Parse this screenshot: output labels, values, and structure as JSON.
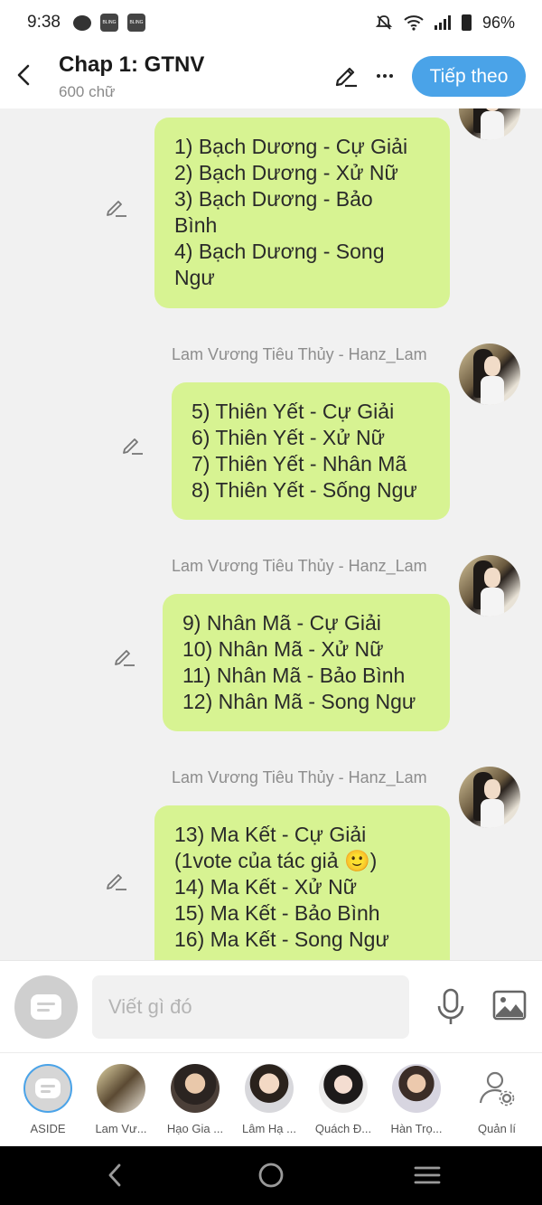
{
  "status_bar": {
    "time": "9:38",
    "battery": "96%",
    "app_icon_text": "BLING"
  },
  "header": {
    "title": "Chap 1: GTNV",
    "subtitle": "600 chữ",
    "next_label": "Tiếp theo"
  },
  "messages": [
    {
      "sender": "",
      "lines": [
        "1) Bạch Dương - Cự Giải",
        "2) Bạch Dương - Xử Nữ",
        "3) Bạch Dương - Bảo",
        "Bình",
        "4) Bạch Dương - Song",
        "Ngư"
      ]
    },
    {
      "sender": "Lam Vương Tiêu Thủy - Hanz_Lam",
      "lines": [
        "5) Thiên Yết - Cự Giải",
        "6) Thiên Yết - Xử Nữ",
        "7) Thiên Yết - Nhân Mã",
        "8) Thiên Yết - Sống Ngư"
      ]
    },
    {
      "sender": "Lam Vương Tiêu Thủy - Hanz_Lam",
      "lines": [
        "9) Nhân Mã - Cự Giải",
        "10) Nhân Mã - Xử Nữ",
        "11) Nhân Mã - Bảo Bình",
        "12) Nhân Mã - Song Ngư"
      ]
    },
    {
      "sender": "Lam Vương Tiêu Thủy - Hanz_Lam",
      "lines": [
        "13) Ma Kết - Cự Giải",
        "(1vote của tác giả 🙂)",
        "14) Ma Kết - Xử Nữ",
        "15) Ma Kết - Bảo Bình",
        "16) Ma Kết - Song Ngư"
      ]
    }
  ],
  "input": {
    "placeholder": "Viết gì đó"
  },
  "characters": [
    {
      "label": "ASIDE"
    },
    {
      "label": "Lam Vư..."
    },
    {
      "label": "Hạo Gia ..."
    },
    {
      "label": "Lâm Hạ ..."
    },
    {
      "label": "Quách Đ..."
    },
    {
      "label": "Hàn Trọ..."
    },
    {
      "label": "Quản lí"
    }
  ],
  "colors": {
    "accent": "#4aa3e8",
    "bubble": "#d7f392",
    "background": "#f1f1f1"
  }
}
